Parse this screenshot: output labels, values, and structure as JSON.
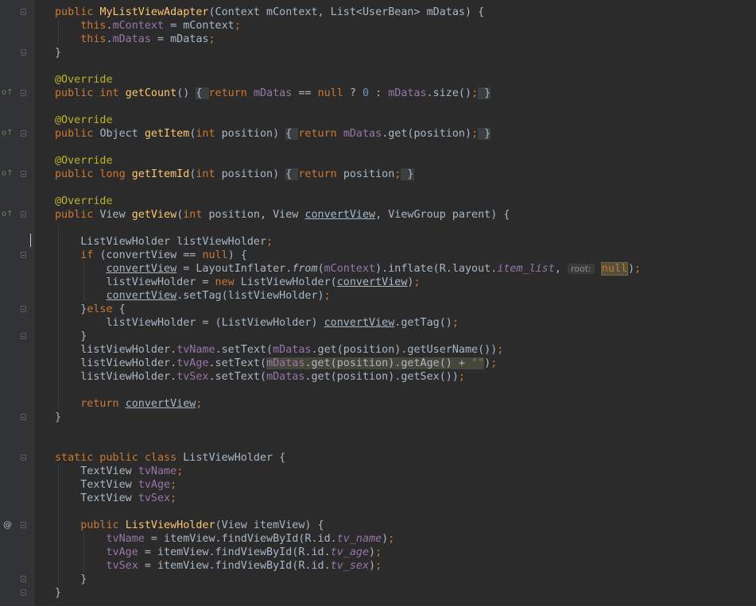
{
  "editor": {
    "theme": "Darcula",
    "colors": {
      "background": "#2b2b2b",
      "gutter": "#313335",
      "keyword": "#cc7832",
      "annotation": "#bbb529",
      "method_decl": "#ffc66d",
      "field": "#9876aa",
      "number": "#6897bb",
      "string": "#6a8759",
      "default_text": "#a9b7c6"
    },
    "gutter_icons": {
      "override": "override-method-icon",
      "implemented": "implementation-at-icon"
    },
    "inlay_hint": "root:",
    "lines": [
      "public MyListViewAdapter(Context mContext, List<UserBean> mDatas) {",
      "    this.mContext = mContext;",
      "    this.mDatas = mDatas;",
      "}",
      "",
      "@Override",
      "public int getCount() { return mDatas == null ? 0 : mDatas.size(); }",
      "",
      "@Override",
      "public Object getItem(int position) { return mDatas.get(position); }",
      "",
      "@Override",
      "public long getItemId(int position) { return position; }",
      "",
      "@Override",
      "public View getView(int position, View convertView, ViewGroup parent) {",
      "",
      "    ListViewHolder listViewHolder;",
      "    if (convertView == null) {",
      "        convertView = LayoutInflater.from(mContext).inflate(R.layout.item_list, root: null);",
      "        listViewHolder = new ListViewHolder(convertView);",
      "        convertView.setTag(listViewHolder);",
      "    }else {",
      "        listViewHolder = (ListViewHolder) convertView.getTag();",
      "    }",
      "    listViewHolder.tvName.setText(mDatas.get(position).getUserName());",
      "    listViewHolder.tvAge.setText(mDatas.get(position).getAge() + \"\");",
      "    listViewHolder.tvSex.setText(mDatas.get(position).getSex());",
      "",
      "    return convertView;",
      "}",
      "",
      "",
      "static public class ListViewHolder {",
      "    TextView tvName;",
      "    TextView tvAge;",
      "    TextView tvSex;",
      "",
      "    public ListViewHolder(View itemView) {",
      "        tvName = itemView.findViewById(R.id.tv_name);",
      "        tvAge = itemView.findViewById(R.id.tv_age);",
      "        tvSex = itemView.findViewById(R.id.tv_sex);",
      "    }",
      "}"
    ]
  }
}
